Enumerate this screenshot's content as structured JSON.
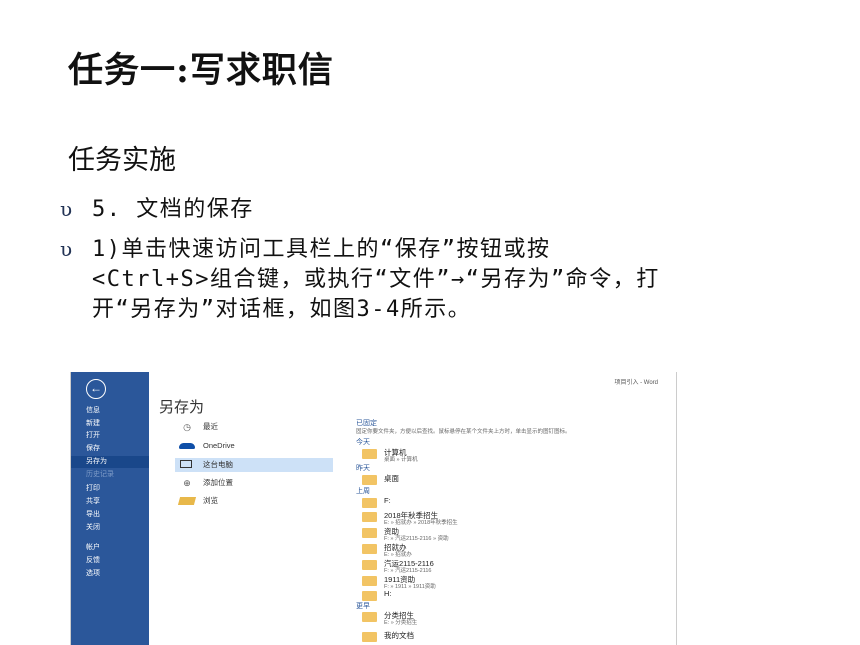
{
  "title": "任务一:写求职信",
  "section_heading": "任务实施",
  "bullet_symbol": "υ",
  "bullets": [
    "5. 文档的保存",
    "1)单击快速访问工具栏上的“保存”按钮或按<Ctrl+S>组合键，或执行“文件”→“另存为”命令，打开“另存为”对话框，如图3-4所示。"
  ],
  "figure": {
    "top_right": "项目引入 - Word",
    "back_glyph": "←",
    "heading": "另存为",
    "sidebar": [
      "信息",
      "新建",
      "打开",
      "保存",
      "另存为",
      "历史记录",
      "打印",
      "共享",
      "导出",
      "关闭",
      "帐户",
      "反馈",
      "选项"
    ],
    "locations": [
      "最近",
      "OneDrive",
      "这台电脑",
      "添加位置",
      "浏览"
    ],
    "pinned_label": "已固定",
    "pinned_note": "固定你要文件夹，方便以后查找。鼠标悬停在某个文件夹上方时，单击显示的图钉图标。",
    "today_label": "今天",
    "yesterday_label": "昨天",
    "lastweek_label": "上周",
    "earlier_label": "更早",
    "folders": {
      "computer": {
        "name": "计算机",
        "path": "桌面 » 计算机"
      },
      "desktop": {
        "name": "桌面",
        "path": ""
      },
      "f_drive": {
        "name": "F:",
        "path": ""
      },
      "autumn": {
        "name": "2018年秋季招生",
        "path": "E: » 招就办 » 2018年秋季招生"
      },
      "subsidy": {
        "name": "资助",
        "path": "F: » 汽运2115-2116 » 资助"
      },
      "office": {
        "name": "招就办",
        "path": "E: » 招就办"
      },
      "class": {
        "name": "汽运2115-2116",
        "path": "F: » 汽运2115-2116"
      },
      "subsidy1911": {
        "name": "1911资助",
        "path": "F: » 1911 » 1911资助"
      },
      "h_drive": {
        "name": "H:",
        "path": ""
      },
      "category": {
        "name": "分类招生",
        "path": "E: » 分类招生"
      },
      "mydocs": {
        "name": "我的文档",
        "path": ""
      }
    },
    "colors": {
      "sidebar": "#2b579a",
      "selected": "#cde1f7",
      "folder": "#f2c464",
      "accent": "#2b579a"
    }
  }
}
